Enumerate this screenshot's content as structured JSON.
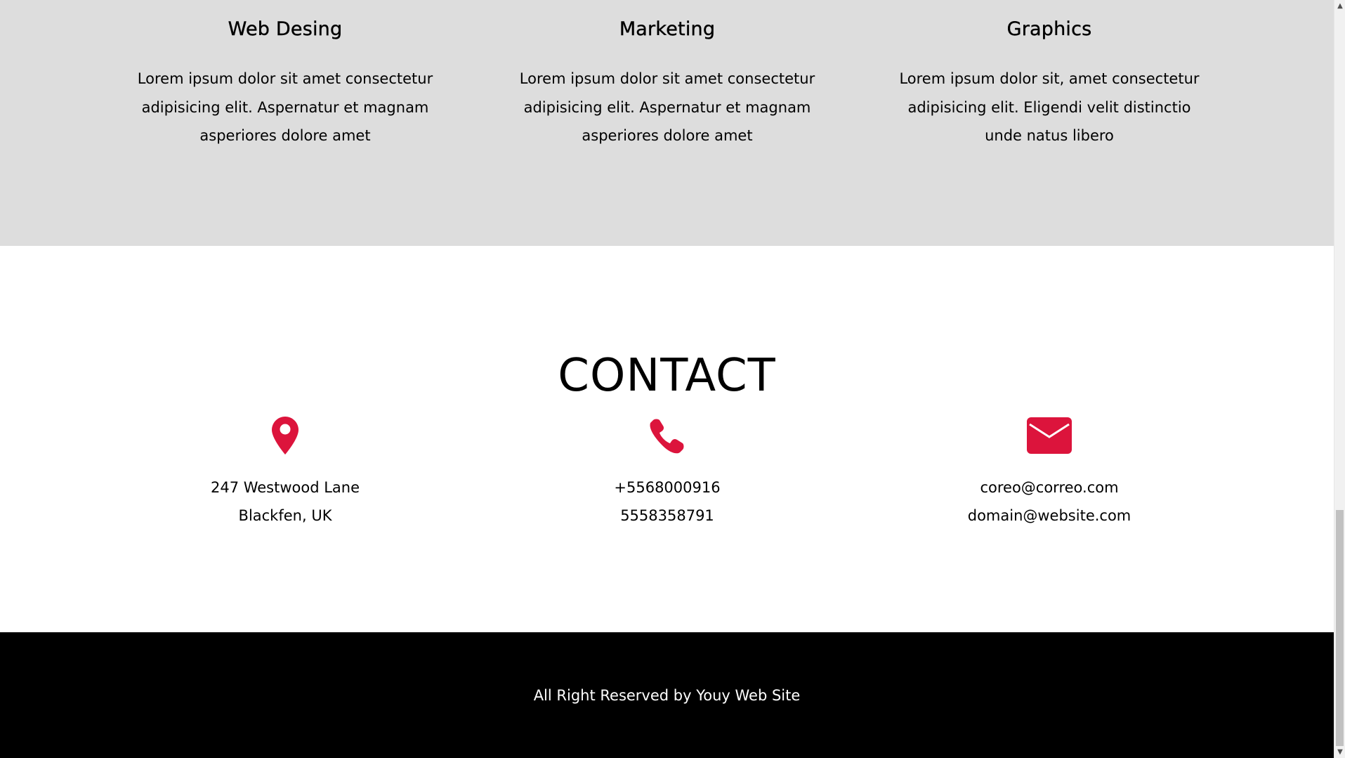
{
  "services": [
    {
      "title": "Web Desing",
      "lines": [
        "Lorem ipsum dolor sit amet consectetur",
        "adipisicing elit. Aspernatur et magnam",
        "asperiores dolore amet"
      ]
    },
    {
      "title": "Marketing",
      "lines": [
        "Lorem ipsum dolor sit amet consectetur",
        "adipisicing elit. Aspernatur et magnam",
        "asperiores dolore amet"
      ]
    },
    {
      "title": "Graphics",
      "lines": [
        "Lorem ipsum dolor sit, amet consectetur",
        "adipisicing elit. Eligendi velit distinctio",
        "unde natus libero"
      ]
    }
  ],
  "contact": {
    "title": "CONTACT",
    "items": [
      {
        "icon": "map-pin-icon",
        "lines": [
          "247 Westwood Lane",
          "Blackfen, UK"
        ]
      },
      {
        "icon": "phone-icon",
        "lines": [
          "+5568000916",
          "5558358791"
        ]
      },
      {
        "icon": "envelope-icon",
        "lines": [
          "coreo@correo.com",
          "domain@website.com"
        ]
      }
    ]
  },
  "footer": {
    "text": "All Right Reserved by Youy Web Site"
  },
  "colors": {
    "accent": "#dc143c",
    "services_bg": "#dddddd",
    "footer_bg": "#000000"
  }
}
